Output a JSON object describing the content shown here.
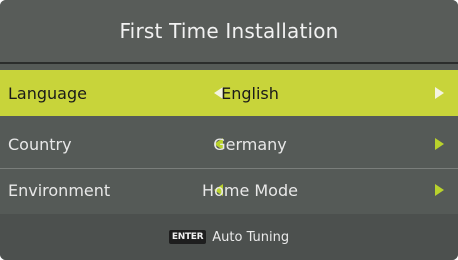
{
  "title": "First Time Installation",
  "rows": [
    {
      "label": "Language",
      "value": "English",
      "selected": true
    },
    {
      "label": "Country",
      "value": "Germany",
      "selected": false
    },
    {
      "label": "Environment",
      "value": "Home Mode",
      "selected": false
    }
  ],
  "footer": {
    "key_label": "ENTER",
    "action_label": "Auto Tuning"
  },
  "colors": {
    "selected_row": "#c8d43a",
    "arrow": "#b9d22c",
    "panel": "#555a57"
  },
  "icons": {
    "left": "left-triangle-icon",
    "right": "right-triangle-icon"
  }
}
